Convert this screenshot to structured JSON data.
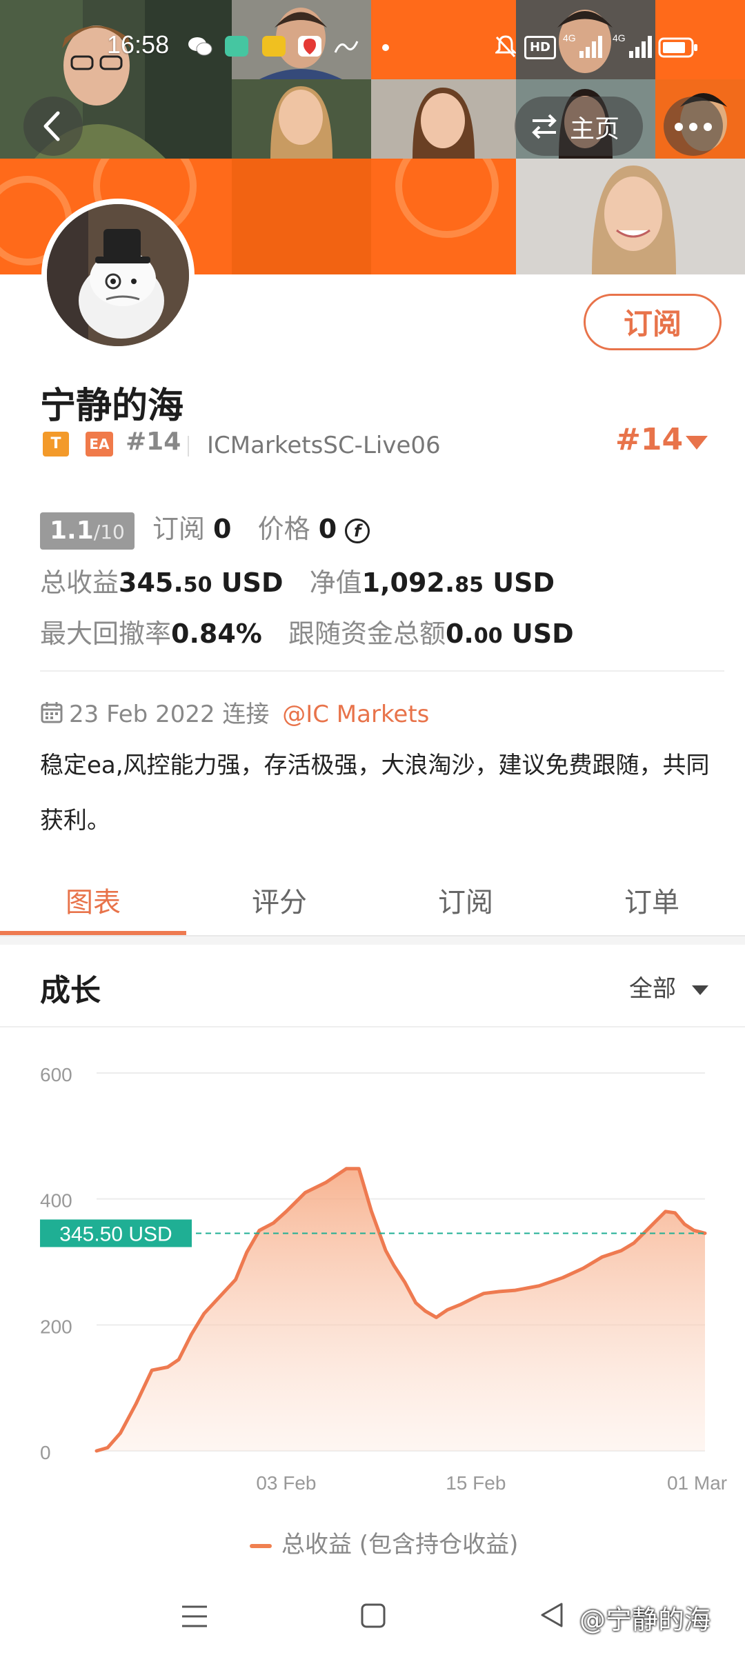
{
  "status_bar": {
    "time": "16:58",
    "network_labels": [
      "HD",
      "4G",
      "4G"
    ]
  },
  "header": {
    "back_icon": "chevron-left-icon",
    "switch_label": "主页",
    "switch_icon": "swap-arrows-icon",
    "more_icon": "more-dots-icon"
  },
  "profile": {
    "subscribe_label": "订阅",
    "name": "宁静的海",
    "badge_t": "T",
    "badge_ea": "EA",
    "rank_small": "#14",
    "server": "ICMarketsSC-Live06",
    "rank_big": "#14"
  },
  "stats": {
    "rating_value": "1.1",
    "rating_max": "/10",
    "subs_label": "订阅",
    "subs_value": "0",
    "price_label": "价格",
    "price_value": "0",
    "price_icon": "currency-f-icon",
    "total_profit_label": "总收益",
    "total_profit_int": "345.",
    "total_profit_dec": "50",
    "total_profit_unit": "USD",
    "equity_label": "净值",
    "equity_int": "1,092.",
    "equity_dec": "85",
    "equity_unit": "USD",
    "max_dd_label": "最大回撤率",
    "max_dd_value": "0.84%",
    "follow_label": "跟随资金总额",
    "follow_int": "0.",
    "follow_dec": "00",
    "follow_unit": "USD"
  },
  "info": {
    "calendar_icon": "calendar-icon",
    "since_date": "23 Feb 2022",
    "connect_label": "连接",
    "broker_link": "@IC Markets",
    "description": "稳定ea,风控能力强，存活极强，大浪淘沙，建议免费跟随，共同获利。"
  },
  "tabs": [
    {
      "label": "图表",
      "active": true
    },
    {
      "label": "评分",
      "active": false
    },
    {
      "label": "订阅",
      "active": false
    },
    {
      "label": "订单",
      "active": false
    }
  ],
  "section": {
    "title": "成长",
    "filter_label": "全部"
  },
  "colors": {
    "accent": "#e8734a",
    "header_orange": "#ff6a1a",
    "line": "#ee7a50",
    "fill_top": "#f6b99a",
    "marker": "#1faf94"
  },
  "chart_data": {
    "type": "area",
    "title": "",
    "xlabel": "",
    "ylabel": "",
    "ylim": [
      0,
      600
    ],
    "yticks": [
      0,
      200,
      400,
      600
    ],
    "x_tick_labels": [
      "03 Feb",
      "15 Feb",
      "01 Mar"
    ],
    "x_tick_positions_days": [
      9,
      21,
      35
    ],
    "current_value_label": "345.50 USD",
    "current_value": 345.5,
    "legend": "总收益 (包含持仓收益)",
    "grid": true,
    "series": [
      {
        "name": "总收益 (包含持仓收益)",
        "x": [
          -3,
          -2.3,
          -1.5,
          -0.5,
          0.5,
          1.5,
          2.2,
          3,
          3.8,
          4.8,
          5.8,
          6.5,
          7.3,
          8.2,
          9,
          9.6,
          10.2,
          11.5,
          12.8,
          13.6,
          14.4,
          15.3,
          15.8,
          16.5,
          17.2,
          17.8,
          18.5,
          19.2,
          20,
          20.8,
          21.5,
          22.5,
          23.5,
          25,
          26.5,
          27.8,
          29,
          30.2,
          31,
          32,
          33,
          33.6,
          34.2,
          34.8,
          35.5
        ],
        "y": [
          0,
          5,
          28,
          75,
          128,
          133,
          145,
          185,
          218,
          245,
          272,
          315,
          350,
          362,
          380,
          395,
          410,
          426,
          448,
          448,
          380,
          318,
          295,
          268,
          235,
          222,
          212,
          224,
          232,
          242,
          250,
          253,
          255,
          262,
          275,
          290,
          308,
          318,
          330,
          355,
          380,
          378,
          360,
          350,
          345.5
        ]
      }
    ]
  },
  "navbar": {
    "menu_icon": "menu-lines-icon",
    "home_icon": "home-square-icon",
    "back_icon": "back-triangle-icon"
  },
  "watermark": "@宁静的海"
}
